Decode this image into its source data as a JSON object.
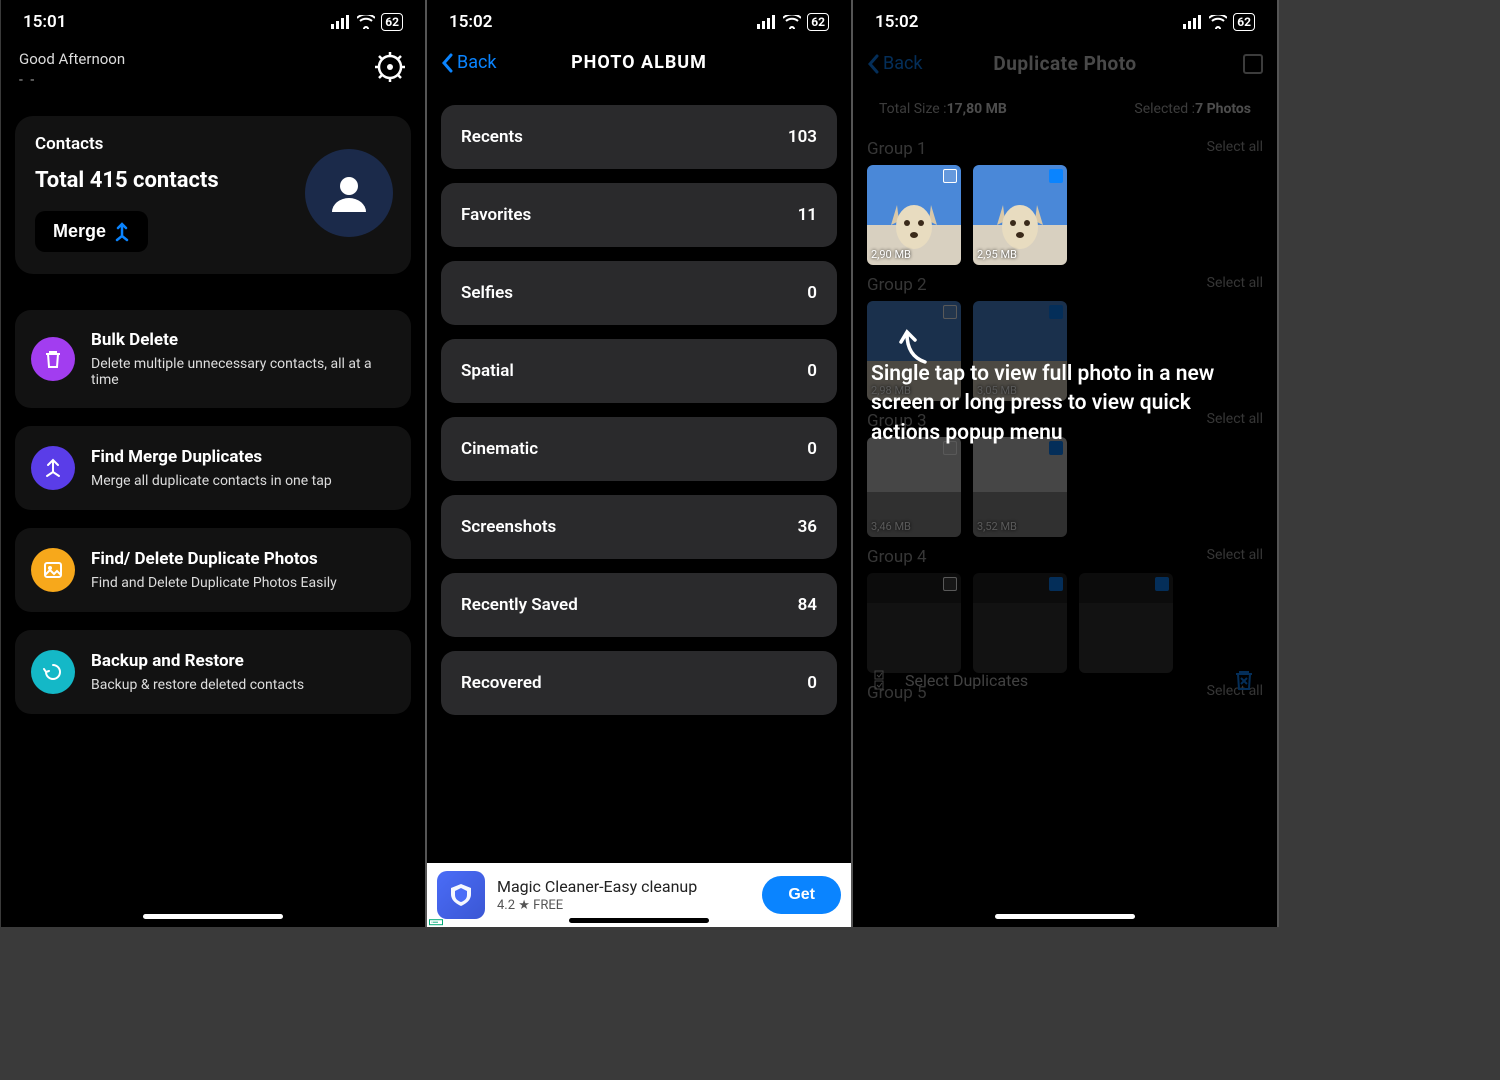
{
  "status": {
    "time1": "15:01",
    "time2": "15:02",
    "time3": "15:02",
    "battery": "62"
  },
  "screen1": {
    "greeting": "Good Afternoon",
    "greeting_sub": "- -",
    "contacts_title": "Contacts",
    "contacts_total": "Total 415 contacts",
    "merge_label": "Merge",
    "menu": [
      {
        "title": "Bulk Delete",
        "sub": "Delete multiple unnecessary contacts, all at a time"
      },
      {
        "title": "Find Merge Duplicates",
        "sub": "Merge all duplicate contacts in one tap"
      },
      {
        "title": "Find/ Delete Duplicate Photos",
        "sub": "Find and Delete Duplicate Photos Easily"
      },
      {
        "title": "Backup and Restore",
        "sub": "Backup & restore deleted contacts"
      }
    ]
  },
  "screen2": {
    "back": "Back",
    "title": "PHOTO ALBUM",
    "albums": [
      {
        "name": "Recents",
        "count": "103"
      },
      {
        "name": "Favorites",
        "count": "11"
      },
      {
        "name": "Selfies",
        "count": "0"
      },
      {
        "name": "Spatial",
        "count": "0"
      },
      {
        "name": "Cinematic",
        "count": "0"
      },
      {
        "name": "Screenshots",
        "count": "36"
      },
      {
        "name": "Recently Saved",
        "count": "84"
      },
      {
        "name": "Recovered",
        "count": "0"
      }
    ],
    "ad": {
      "title": "Magic Cleaner-Easy cleanup",
      "meta": "4.2 ★  FREE",
      "cta": "Get"
    }
  },
  "screen3": {
    "back": "Back",
    "title": "Duplicate Photo",
    "total_size_label": "Total Size :",
    "total_size": "17,80 MB",
    "selected_label": "Selected :",
    "selected": "7 Photos",
    "select_all": "Select all",
    "groups": [
      {
        "name": "Group 1",
        "thumbs": [
          {
            "size": "2,90 MB"
          },
          {
            "size": "2,95 MB"
          }
        ]
      },
      {
        "name": "Group 2",
        "thumbs": [
          {
            "size": "2,98 MB"
          },
          {
            "size": "3,05 MB"
          }
        ]
      },
      {
        "name": "Group 3",
        "thumbs": [
          {
            "size": "3,46 MB"
          },
          {
            "size": "3,52 MB"
          }
        ]
      },
      {
        "name": "Group 4",
        "thumbs": [
          {
            "size": ""
          },
          {
            "size": ""
          },
          {
            "size": ""
          }
        ]
      },
      {
        "name": "Group 5",
        "thumbs": []
      }
    ],
    "select_duplicates": "Select Duplicates",
    "tip": "Single tap to view full photo in a new screen or long press to view quick actions popup menu"
  }
}
